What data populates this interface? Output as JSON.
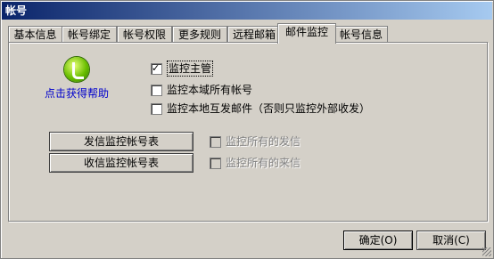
{
  "window": {
    "title": "帐号"
  },
  "tabs": [
    {
      "label": "基本信息"
    },
    {
      "label": "帐号绑定"
    },
    {
      "label": "帐号权限"
    },
    {
      "label": "更多规则"
    },
    {
      "label": "远程邮箱"
    },
    {
      "label": "邮件监控",
      "active": true
    },
    {
      "label": "帐号信息"
    }
  ],
  "help": {
    "link_text": "点击获得帮助"
  },
  "options": {
    "monitor_admin": {
      "label": "监控主管",
      "checked": true
    },
    "monitor_domain_accounts": {
      "label": "监控本域所有帐号",
      "checked": false
    },
    "monitor_local_mail": {
      "label": "监控本地互发邮件（否则只监控外部收发）",
      "checked": false
    }
  },
  "buttons": {
    "send_list": "发信监控帐号表",
    "receive_list": "收信监控帐号表",
    "ok": "确定(O)",
    "cancel": "取消(C)"
  },
  "disabled_options": {
    "monitor_all_sent": {
      "label": "监控所有的发信",
      "checked": false
    },
    "monitor_all_received": {
      "label": "监控所有的来信",
      "checked": false
    }
  }
}
